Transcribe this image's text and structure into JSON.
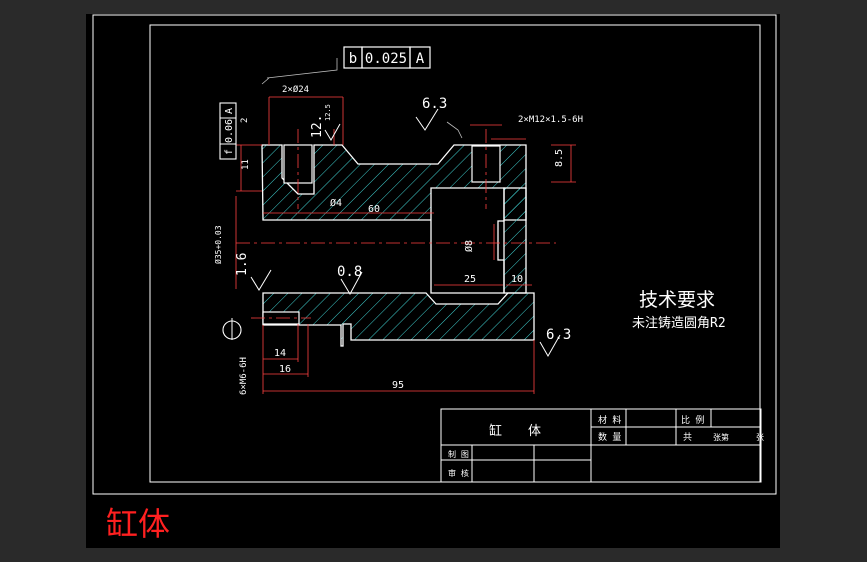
{
  "caption": "缸体",
  "callout": {
    "datum_letter": "b",
    "tolerance": "0.025",
    "datum_ref": "A"
  },
  "left_tolerance": {
    "symbol": "f",
    "value": "0.06",
    "datum": "A"
  },
  "roughness": {
    "top_left": "6.3",
    "small_hole": "12.5",
    "upper_12": "12.",
    "bore": "0.8",
    "left_1": "1.6",
    "bottom_right": "6.3"
  },
  "dims": {
    "counterbore": "2×Ø24",
    "thread_top": "2×M12×1.5-6H",
    "d_2": "2",
    "d_11": "11",
    "d_85": "8.5",
    "d_phi4": "Ø4",
    "d_60": "60",
    "d_phi8": "Ø8",
    "d_bore": "Ø35+0.03",
    "d_25": "25",
    "d_10": "10",
    "d_14": "14",
    "d_16": "16",
    "d_95": "95",
    "thread_side": "6×M6-6H"
  },
  "tech": {
    "title": "技术要求",
    "note": "未注铸造圆角R2"
  },
  "title_block": {
    "part_name_1": "缸",
    "part_name_2": "体",
    "material": "材 料",
    "scale": "比 例",
    "quantity": "数 量",
    "total": "共",
    "sheet": "张第",
    "sheet_end": "张",
    "drawn": "制 图",
    "checked": "审 核"
  }
}
